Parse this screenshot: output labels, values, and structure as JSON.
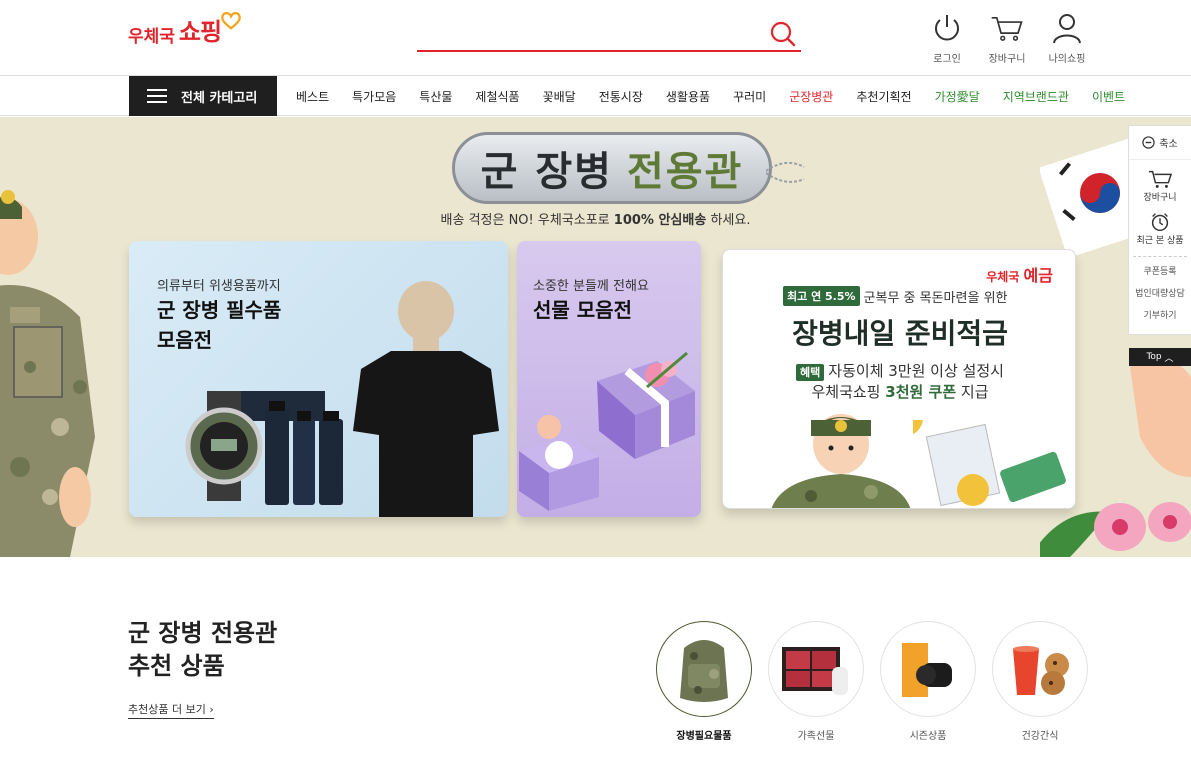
{
  "header": {
    "logo_small": "우체국",
    "logo_big": "쇼핑",
    "search_placeholder": "",
    "util": [
      {
        "label": "로그인",
        "icon": "power-icon"
      },
      {
        "label": "장바구니",
        "icon": "cart-icon"
      },
      {
        "label": "나의쇼핑",
        "icon": "user-icon"
      }
    ]
  },
  "nav": {
    "all_categories": "전체 카테고리",
    "items": [
      {
        "label": "베스트",
        "color": "#222222"
      },
      {
        "label": "특가모음",
        "color": "#222222"
      },
      {
        "label": "특산물",
        "color": "#222222"
      },
      {
        "label": "제철식품",
        "color": "#222222"
      },
      {
        "label": "꽃배달",
        "color": "#222222"
      },
      {
        "label": "전통시장",
        "color": "#222222"
      },
      {
        "label": "생활용품",
        "color": "#222222"
      },
      {
        "label": "꾸러미",
        "color": "#222222"
      },
      {
        "label": "군장병관",
        "color": "#e0262c"
      },
      {
        "label": "추천기획전",
        "color": "#222222"
      },
      {
        "label": "가정愛달",
        "color": "#2e8b2e"
      },
      {
        "label": "지역브랜드관",
        "color": "#2e8b2e"
      },
      {
        "label": "이벤트",
        "color": "#2e8b2e"
      }
    ]
  },
  "banner": {
    "title_part1": "군 장병",
    "title_part2": "전용관",
    "subtitle_pre": "배송 걱정은 NO! 우체국소포로 ",
    "subtitle_bold": "100% 안심배송",
    "subtitle_post": " 하세요.",
    "card1": {
      "sub": "의류부터 위생용품까지",
      "title1": "군 장병 필수품",
      "title2": "모음전"
    },
    "card2": {
      "sub": "소중한 분들께 전해요",
      "title1": "선물 모음전"
    },
    "card3": {
      "brand_pre": "우체국 ",
      "brand_main": "예금",
      "tag1": "최고 연 5.5%",
      "line1": "군복무 중 목돈마련을 위한",
      "title": "장병내일 준비적금",
      "tag2": "혜택",
      "line2": "자동이체 3만원 이상 설정시",
      "line3_pre": "우체국쇼핑 ",
      "line3_bold": "3천원 쿠폰",
      "line3_post": " 지급"
    }
  },
  "quick": {
    "collapse": "축소",
    "cart": "장바구니",
    "recent": "최근 본 상품",
    "links": [
      "쿠폰등록",
      "법인대량상담",
      "기부하기"
    ],
    "top": "Top"
  },
  "recommend": {
    "title1": "군 장병 전용관",
    "title2": "추천 상품",
    "more": "추천상품 더 보기",
    "categories": [
      {
        "label": "장병필요물품",
        "active": true
      },
      {
        "label": "가족선물",
        "active": false
      },
      {
        "label": "시즌상품",
        "active": false
      },
      {
        "label": "건강간식",
        "active": false
      }
    ]
  }
}
